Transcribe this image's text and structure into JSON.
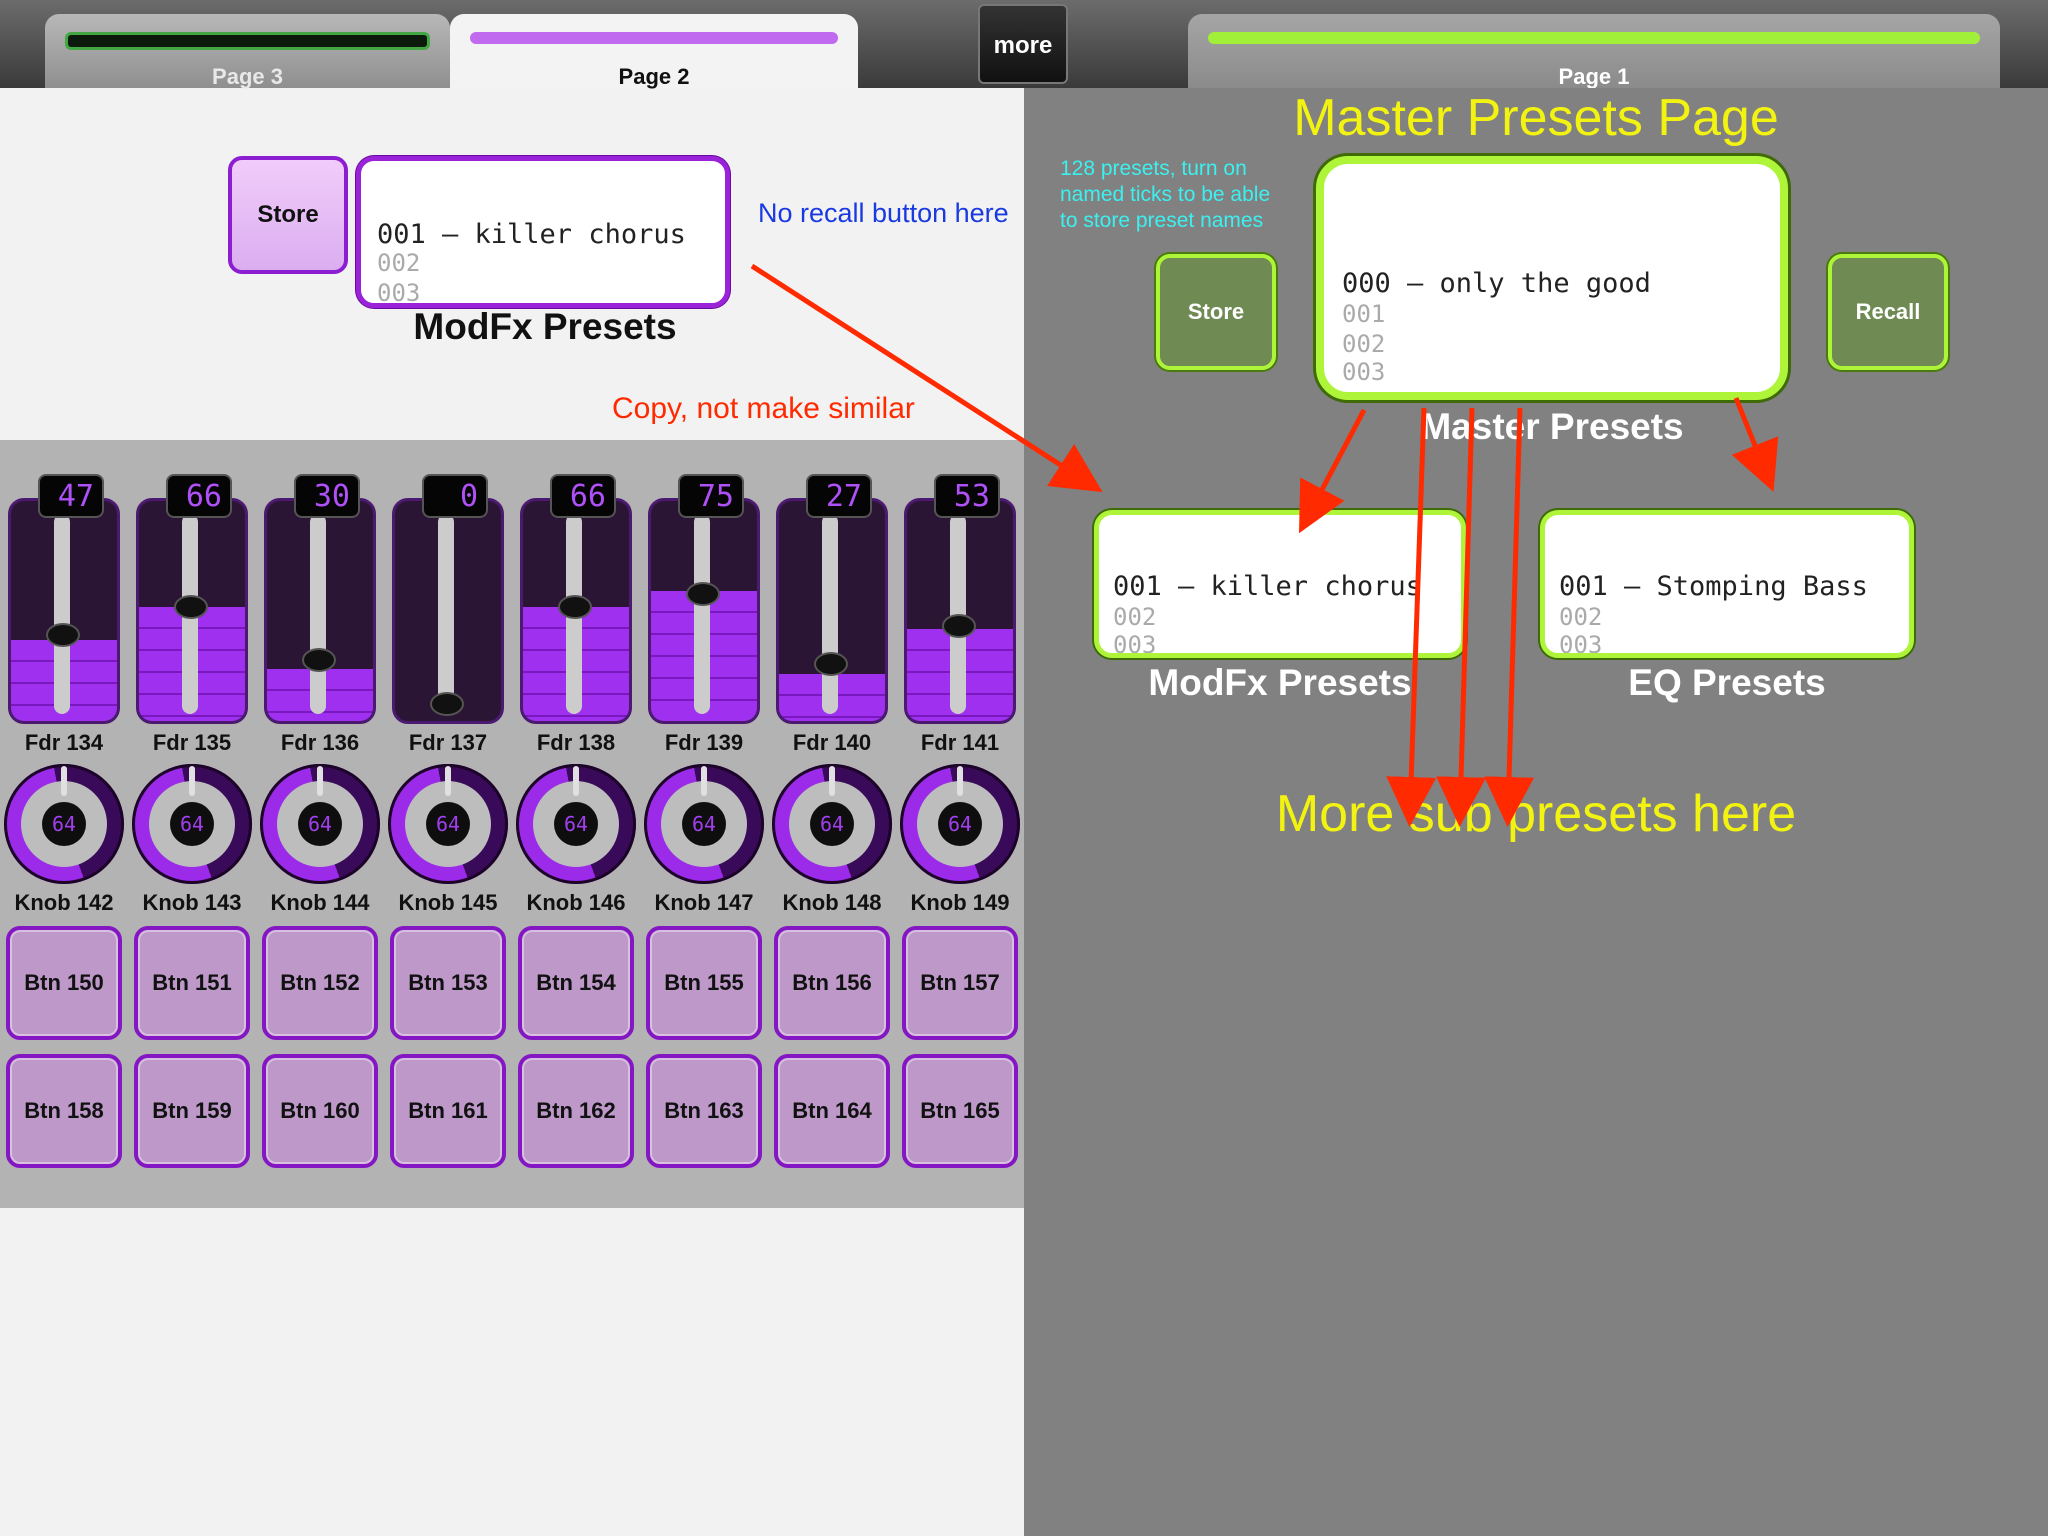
{
  "tabs": {
    "page3": "Page 3",
    "page2": "Page 2",
    "page1": "Page 1",
    "more": "more"
  },
  "colors": {
    "accent_purple": "#9b2be8",
    "accent_green": "#aef53a",
    "annotation_red": "#ff2a00",
    "annotation_blue": "#1a3ae0",
    "annotation_yellow": "#f3f311",
    "annotation_cyan": "#3cf0f0"
  },
  "page2": {
    "store_label": "Store",
    "modfx": {
      "main": "001 – killer chorus",
      "line2": "002",
      "line3": "003",
      "caption": "ModFx Presets"
    },
    "note_recall": "No recall button here",
    "note_copy": "Copy, not make similar",
    "faders": [
      {
        "label": "Fdr 134",
        "value": "47"
      },
      {
        "label": "Fdr 135",
        "value": "66"
      },
      {
        "label": "Fdr 136",
        "value": "30"
      },
      {
        "label": "Fdr 137",
        "value": "0"
      },
      {
        "label": "Fdr 138",
        "value": "66"
      },
      {
        "label": "Fdr 139",
        "value": "75"
      },
      {
        "label": "Fdr 140",
        "value": "27"
      },
      {
        "label": "Fdr 141",
        "value": "53"
      }
    ],
    "knobs": [
      {
        "label": "Knob 142",
        "value": "64"
      },
      {
        "label": "Knob 143",
        "value": "64"
      },
      {
        "label": "Knob 144",
        "value": "64"
      },
      {
        "label": "Knob 145",
        "value": "64"
      },
      {
        "label": "Knob 146",
        "value": "64"
      },
      {
        "label": "Knob 147",
        "value": "64"
      },
      {
        "label": "Knob 148",
        "value": "64"
      },
      {
        "label": "Knob 149",
        "value": "64"
      }
    ],
    "buttons_row1": [
      "Btn 150",
      "Btn 151",
      "Btn 152",
      "Btn 153",
      "Btn 154",
      "Btn 155",
      "Btn 156",
      "Btn 157"
    ],
    "buttons_row2": [
      "Btn 158",
      "Btn 159",
      "Btn 160",
      "Btn 161",
      "Btn 162",
      "Btn 163",
      "Btn 164",
      "Btn 165"
    ]
  },
  "page1": {
    "title": "Master Presets Page",
    "note_ticks_1": "128 presets, turn on",
    "note_ticks_2": "named ticks to be able",
    "note_ticks_3": "to store preset names",
    "store_label": "Store",
    "recall_label": "Recall",
    "master": {
      "main": "000 – only the good",
      "line2": "001",
      "line3": "002",
      "line4": "003",
      "caption": "Master Presets"
    },
    "modfx": {
      "main": "001 – killer chorus",
      "line2": "002",
      "line3": "003",
      "caption": "ModFx Presets"
    },
    "eq": {
      "main": "001 – Stomping Bass",
      "line2": "002",
      "line3": "003",
      "caption": "EQ Presets"
    },
    "note_more": "More sub presets here"
  }
}
